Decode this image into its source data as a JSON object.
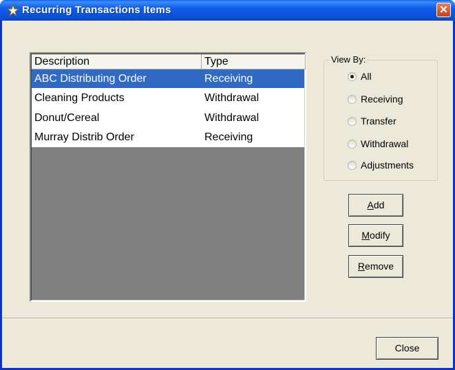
{
  "window": {
    "title": "Recurring Transactions Items",
    "close_glyph": "✕"
  },
  "list": {
    "columns": [
      "Description",
      "Type"
    ],
    "rows": [
      {
        "description": "ABC Distributing Order",
        "type": "Receiving",
        "selected": true
      },
      {
        "description": "Cleaning Products",
        "type": "Withdrawal",
        "selected": false
      },
      {
        "description": "Donut/Cereal",
        "type": "Withdrawal",
        "selected": false
      },
      {
        "description": "Murray Distrib Order",
        "type": "Receiving",
        "selected": false
      }
    ]
  },
  "view_by": {
    "legend": "View By:",
    "options": [
      "All",
      "Receiving",
      "Transfer",
      "Withdrawal",
      "Adjustments"
    ],
    "selected": "All"
  },
  "buttons": {
    "add": {
      "mnemonic": "A",
      "rest": "dd"
    },
    "modify": {
      "mnemonic": "M",
      "rest": "odify"
    },
    "remove": {
      "mnemonic": "R",
      "rest": "emove"
    },
    "close": "Close"
  },
  "colors": {
    "title_bar": "#0A4FD4",
    "selection": "#316AC5",
    "dialog_bg": "#ECE9D8"
  }
}
